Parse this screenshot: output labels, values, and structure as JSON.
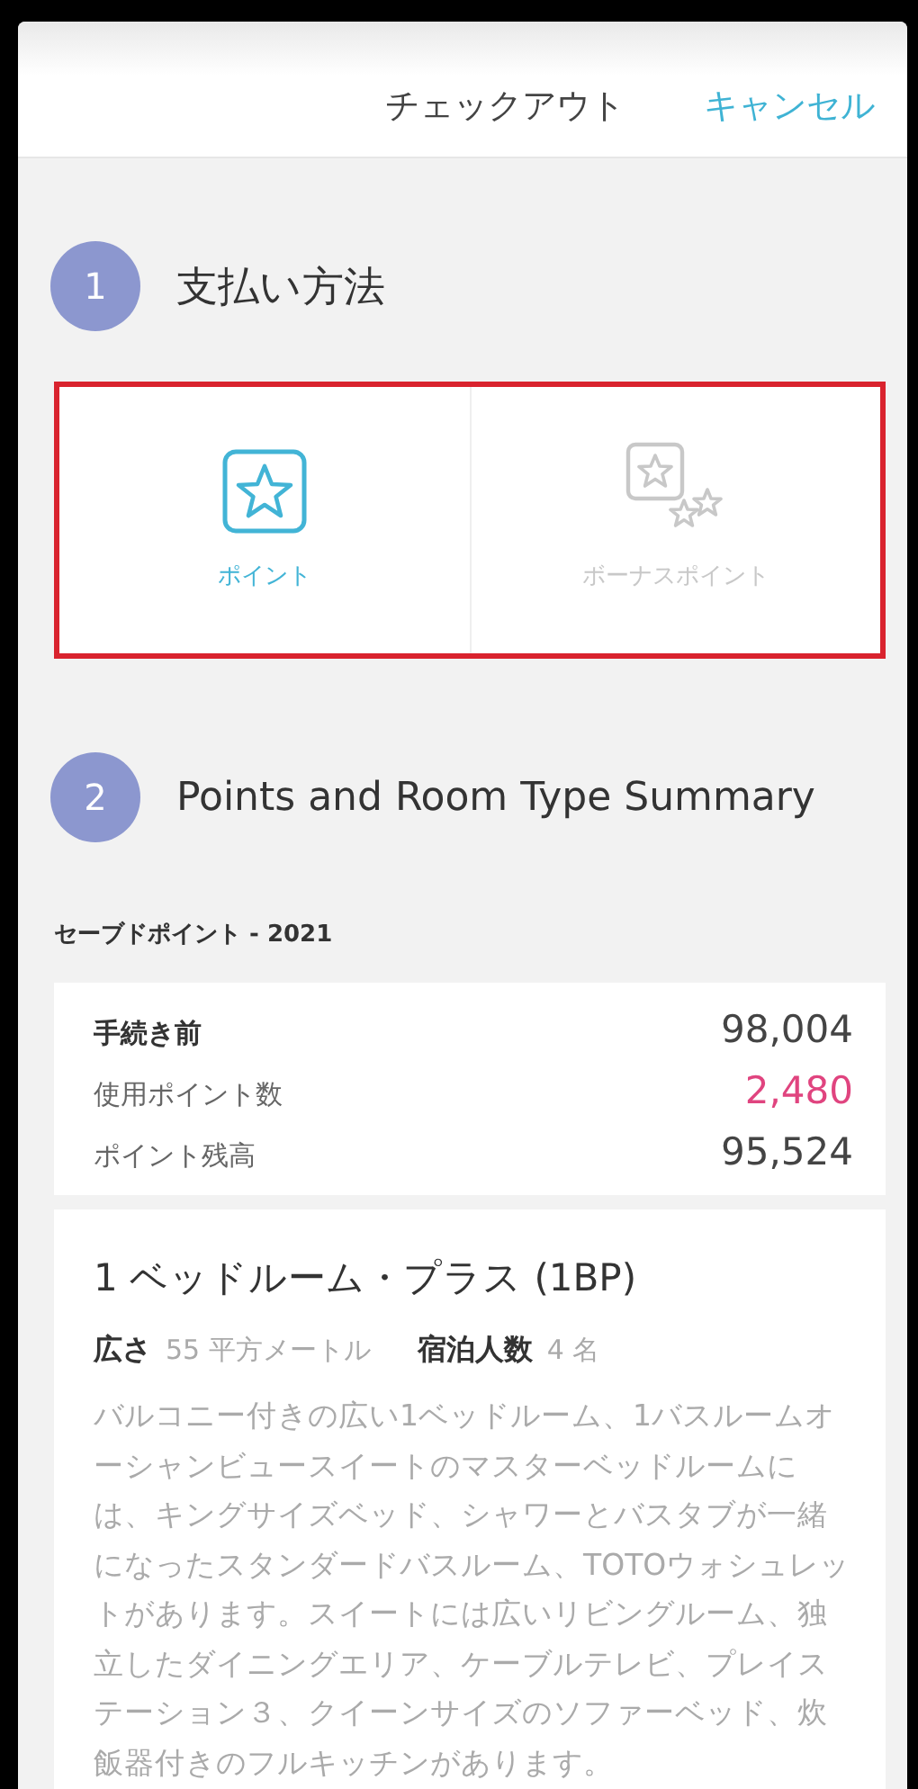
{
  "header": {
    "title": "チェックアウト",
    "cancel": "キャンセル"
  },
  "steps": [
    {
      "number": "1",
      "title": "支払い方法"
    },
    {
      "number": "2",
      "title": "Points and Room Type Summary"
    }
  ],
  "payment_options": [
    {
      "label": "ポイント",
      "kind": "points",
      "selected": true
    },
    {
      "label": "ボーナスポイント",
      "kind": "bonus",
      "selected": false
    }
  ],
  "saved_points_label": "セーブドポイント - 2021",
  "points_rows": [
    {
      "label": "手続き前",
      "value": "98,004",
      "kind": "total"
    },
    {
      "label": "使用ポイント数",
      "value": "2,480",
      "kind": "used"
    },
    {
      "label": "ポイント残高",
      "value": "95,524",
      "kind": "balance"
    }
  ],
  "room": {
    "title": "1 ベッドルーム・プラス (1BP)",
    "specs": [
      {
        "label": "広さ",
        "value": "55 平方メートル"
      },
      {
        "label": "宿泊人数",
        "value": "4 名"
      }
    ],
    "description": "バルコニー付きの広い1ベッドルーム、1バスルームオーシャンビュースイートのマスターベッドルームには、キングサイズベッド、シャワーとバスタブが一緒になったスタンダードバスルーム、TOTOウォシュレットがあります。スイートには広いリビングルーム、独立したダイニングエリア、ケーブルテレビ、プレイステーション３、クイーンサイズのソファーベッド、炊飯器付きのフルキッチンがあります。"
  }
}
